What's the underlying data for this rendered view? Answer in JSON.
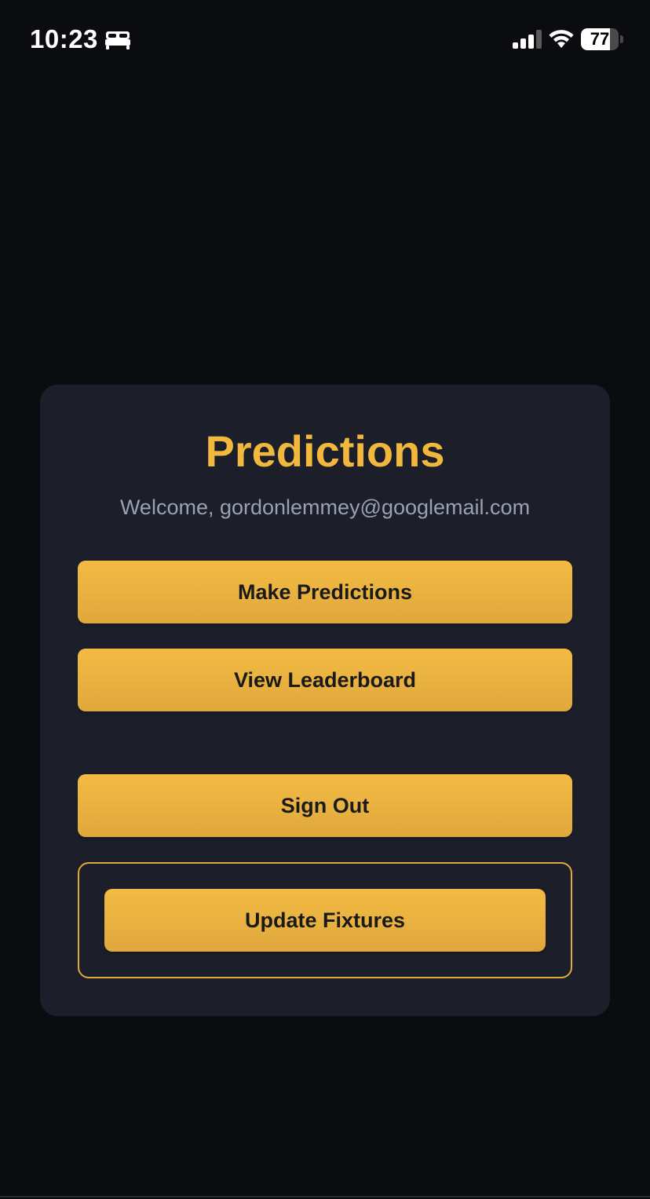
{
  "status_bar": {
    "time": "10:23",
    "focus_icon": "bed-icon",
    "signal_icon": "cellular-signal-icon",
    "wifi_icon": "wifi-icon",
    "battery_percent": "77",
    "battery_level": 0.77
  },
  "card": {
    "title": "Predictions",
    "welcome": "Welcome, gordonlemmey@googlemail.com",
    "buttons": {
      "make_predictions": "Make Predictions",
      "view_leaderboard": "View Leaderboard",
      "sign_out": "Sign Out",
      "update_fixtures": "Update Fixtures"
    }
  },
  "colors": {
    "background": "#0b0c10",
    "card": "#1c1f29",
    "accent": "#f2b73d",
    "muted_text": "#9aa1b3",
    "button_text": "#1a1a1a"
  }
}
